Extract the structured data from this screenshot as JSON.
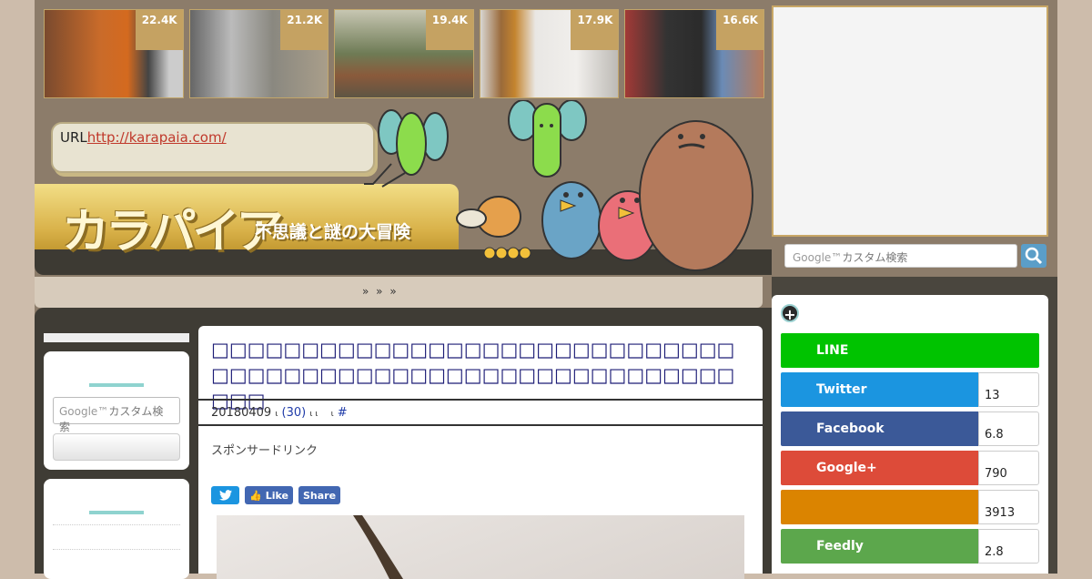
{
  "thumbnails": [
    {
      "count": "22.4K"
    },
    {
      "count": "21.2K"
    },
    {
      "count": "19.4K"
    },
    {
      "count": "17.9K"
    },
    {
      "count": "16.6K"
    }
  ],
  "url_box": {
    "prefix": "URL",
    "link": "http://karapaia.com/"
  },
  "logo": {
    "title": "カラパイア",
    "subtitle": "不思議と謎の大冒険"
  },
  "nav": {
    "crumbs": "»  »      »"
  },
  "google_search": {
    "placeholder": "カスタム検索"
  },
  "sidebar_search": {
    "placeholder": "カスタム検索"
  },
  "article": {
    "title": "□□□□□□□□□□□□□□□□□□□□□□□□□□□□□□□□□□□□□□□□□□□□□□□□□□□□□□□□□□□□□",
    "date": "20180409",
    "comments": "(30)",
    "hash": "#",
    "sponsor": "スポンサードリンク",
    "share_like": "Like",
    "share_share": "Share"
  },
  "share_panel": {
    "items": [
      {
        "label": "LINE",
        "count": "",
        "color": "#00c300"
      },
      {
        "label": "Twitter",
        "count": "13",
        "color": "#1b95e0"
      },
      {
        "label": "Facebook",
        "count": "6.8",
        "color": "#3b5998"
      },
      {
        "label": "Google+",
        "count": "790",
        "color": "#dd4b39"
      },
      {
        "label": "",
        "count": "3913",
        "color": "#db8400"
      },
      {
        "label": "Feedly",
        "count": "2.8",
        "color": "#5ca74c"
      }
    ]
  }
}
